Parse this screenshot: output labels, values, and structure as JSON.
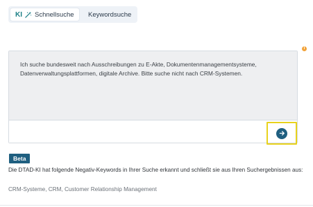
{
  "tabs": {
    "ki_badge": "KI",
    "schnellsuche_label": "Schnellsuche",
    "keywordsuche_label": "Keywordsuche"
  },
  "query": {
    "text": "Ich suche bundesweit nach Ausschreibungen zu E-Akte, Dokumentenmanagementsysteme, Datenverwaltungsplattformen, digitale Archive. Bitte suche nicht nach CRM-Systemen."
  },
  "beta": {
    "label": "Beta"
  },
  "ki_info": {
    "text": "Die DTAD-KI hat folgende Negativ-Keywords in Ihrer Suche erkannt und schließt sie aus Ihren Suchergebnissen aus:",
    "negative_keywords": "CRM-Systeme, CRM, Customer Relationship Management"
  },
  "colors": {
    "accent": "#1f5f80",
    "ki_accent": "#1b7f86",
    "highlight": "#e8d21c",
    "info_icon": "#f2a33a"
  },
  "icons": {
    "wand": "magic-wand-icon",
    "submit": "arrow-right-icon",
    "info": "info-icon"
  }
}
